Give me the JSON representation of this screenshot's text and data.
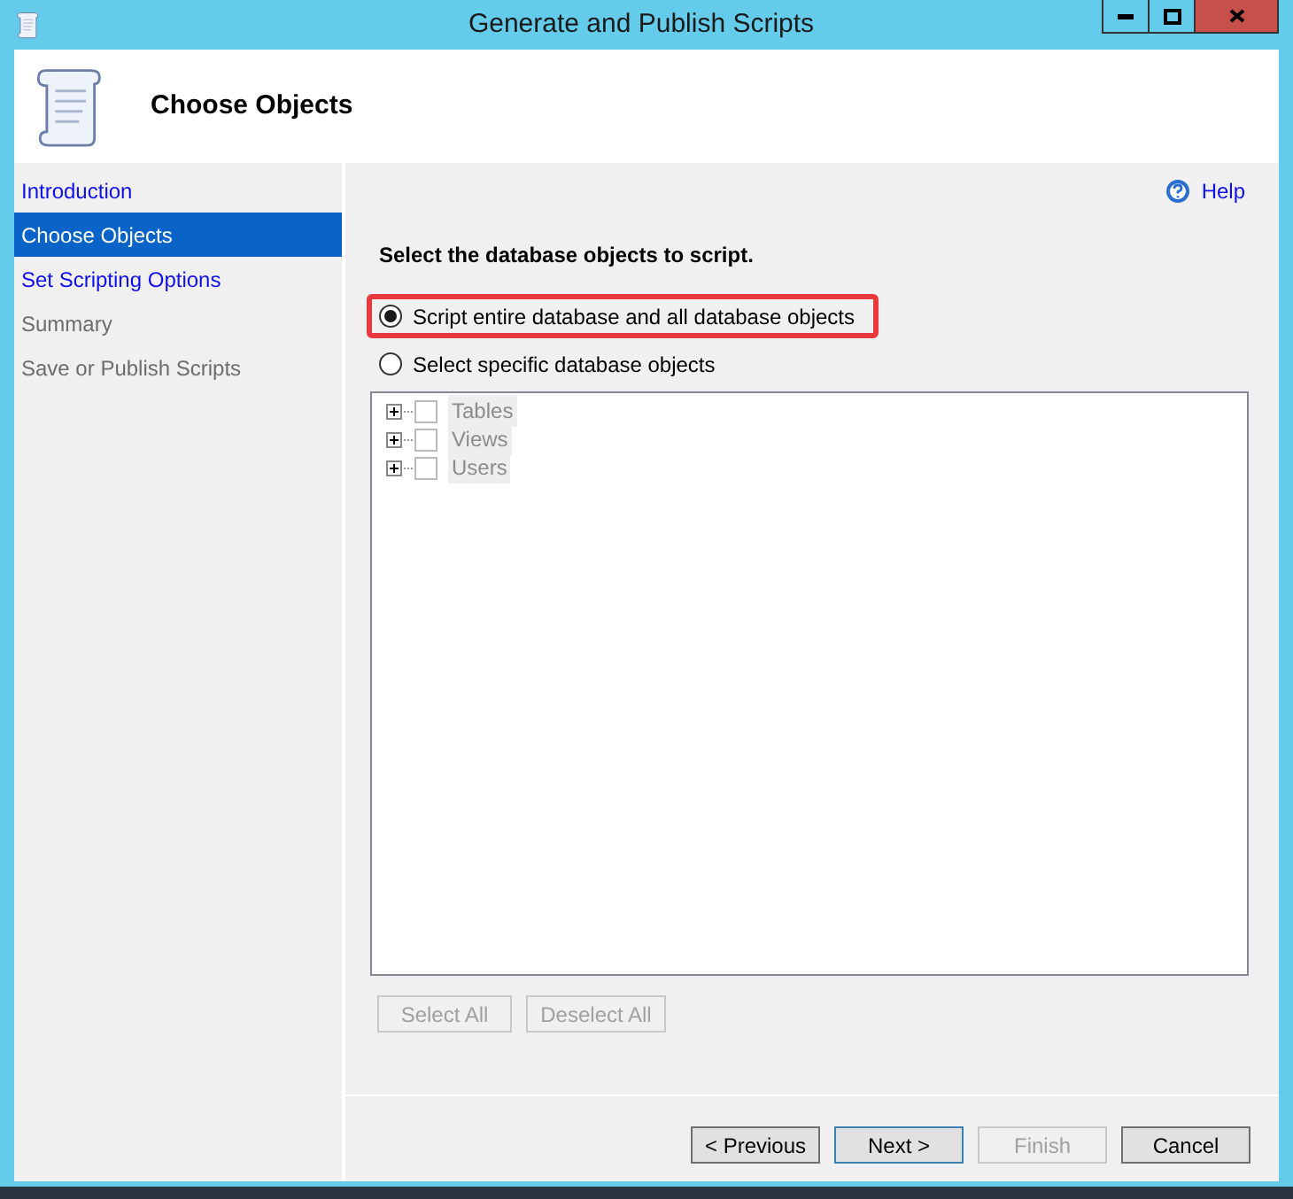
{
  "window": {
    "title": "Generate and Publish Scripts"
  },
  "header": {
    "title": "Choose Objects"
  },
  "sidebar": {
    "items": [
      {
        "label": "Introduction",
        "selected": false,
        "disabled": false
      },
      {
        "label": "Choose Objects",
        "selected": true,
        "disabled": false
      },
      {
        "label": "Set Scripting Options",
        "selected": false,
        "disabled": false
      },
      {
        "label": "Summary",
        "selected": false,
        "disabled": true
      },
      {
        "label": "Save or Publish Scripts",
        "selected": false,
        "disabled": true
      }
    ]
  },
  "help": {
    "label": "Help"
  },
  "heading": "Select the database objects to script.",
  "options": [
    {
      "label": "Script entire database and all database objects",
      "selected": true,
      "highlighted": true
    },
    {
      "label": "Select specific database objects",
      "selected": false,
      "highlighted": false
    }
  ],
  "tree": {
    "disabled": true,
    "items": [
      {
        "label": "Tables",
        "checked": false
      },
      {
        "label": "Views",
        "checked": false
      },
      {
        "label": "Users",
        "checked": false
      }
    ]
  },
  "tree_buttons": [
    {
      "label": "Select All",
      "disabled": true
    },
    {
      "label": "Deselect All",
      "disabled": true
    }
  ],
  "buttons": [
    {
      "label": "< Previous",
      "disabled": false,
      "default": false
    },
    {
      "label": "Next >",
      "disabled": false,
      "default": true
    },
    {
      "label": "Finish",
      "disabled": true,
      "default": false
    },
    {
      "label": "Cancel",
      "disabled": false,
      "default": false
    }
  ]
}
